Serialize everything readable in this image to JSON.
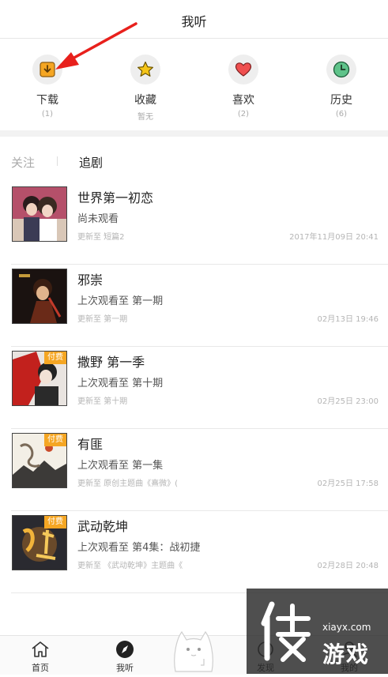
{
  "header": {
    "title": "我听"
  },
  "quick_actions": [
    {
      "label": "下载",
      "count": "(1)",
      "icon": "download-icon"
    },
    {
      "label": "收藏",
      "count": "暂无",
      "icon": "star-icon"
    },
    {
      "label": "喜欢",
      "count": "(2)",
      "icon": "heart-icon"
    },
    {
      "label": "历史",
      "count": "(6)",
      "icon": "clock-icon"
    }
  ],
  "tabs": {
    "follow": "关注",
    "drama": "追剧"
  },
  "items": [
    {
      "title": "世界第一初恋",
      "status": "尚未观看",
      "update": "更新至 短篇2",
      "time": "2017年11月09日 20:41",
      "paid": ""
    },
    {
      "title": "邪崇",
      "status": "上次观看至 第一期",
      "update": "更新至 第一期",
      "time": "02月13日 19:46",
      "paid": ""
    },
    {
      "title": "撒野 第一季",
      "status": "上次观看至 第十期",
      "update": "更新至 第十期",
      "time": "02月25日 23:00",
      "paid": "付费"
    },
    {
      "title": "有匪",
      "status": "上次观看至 第一集",
      "update": "更新至 原创主题曲《熹微》(",
      "time": "02月25日 17:58",
      "paid": "付费"
    },
    {
      "title": "武动乾坤",
      "status": "上次观看至 第4集：战初捷",
      "update": "更新至 《武动乾坤》主题曲《",
      "time": "02月28日 20:48",
      "paid": "付费"
    }
  ],
  "bottom_nav": [
    {
      "label": "首页",
      "icon": "home-icon"
    },
    {
      "label": "我听",
      "icon": "compass-icon"
    },
    {
      "label": "发现",
      "icon": "discover-icon"
    },
    {
      "label": "我的",
      "icon": "profile-icon"
    }
  ],
  "watermark": {
    "url": "xiayx.com",
    "text": "游戏"
  },
  "colors": {
    "accent_orange": "#f5a623",
    "arrow_red": "#e8201c",
    "heart_red": "#ef4f4f",
    "clock_green": "#49b67a",
    "star_yellow": "#f5c518"
  }
}
